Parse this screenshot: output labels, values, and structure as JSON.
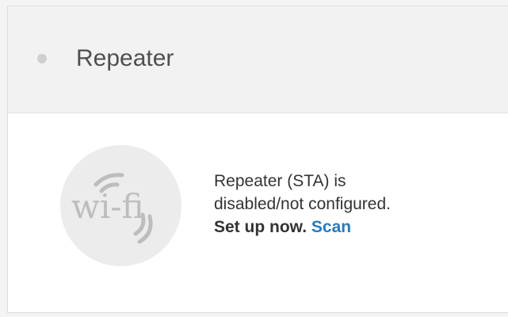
{
  "panel": {
    "title": "Repeater",
    "status_color": "#cfcfcf"
  },
  "body": {
    "icon": "wifi-logo-icon",
    "icon_text": "wi-fi",
    "message_line1": "Repeater (STA) is",
    "message_line2": "disabled/not configured.",
    "setup_label": "Set up now.",
    "scan_label": "Scan"
  },
  "colors": {
    "link": "#2a7ab8",
    "header_bg": "#f2f2f2",
    "icon_bg": "#ececec",
    "icon_fg": "#bdbdbd"
  }
}
